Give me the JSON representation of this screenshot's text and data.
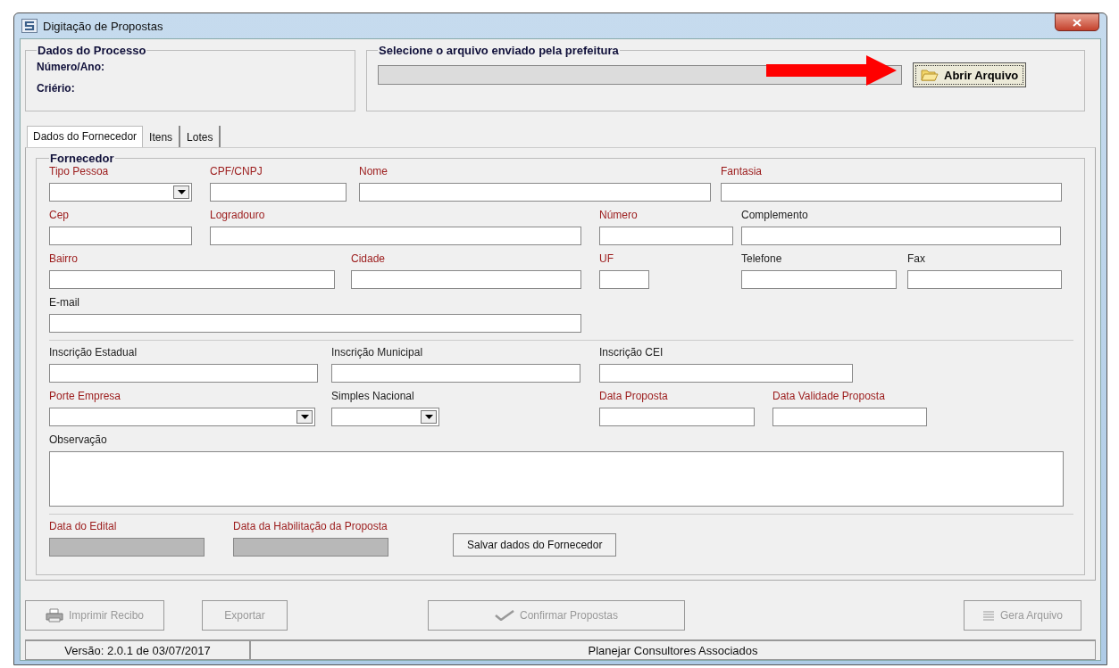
{
  "window": {
    "title": "Digitação de Propostas"
  },
  "process_group": {
    "title": "Dados do Processo",
    "lines": [
      "Número/Ano:",
      "Criério:"
    ]
  },
  "file_group": {
    "title": "Selecione o arquivo enviado pela prefeitura",
    "button": "Abrir Arquivo"
  },
  "tabs": [
    {
      "label": "Dados do Fornecedor",
      "selected": true
    },
    {
      "label": "Itens",
      "selected": false
    },
    {
      "label": "Lotes",
      "selected": false
    }
  ],
  "supplier": {
    "title": "Fornecedor",
    "field_lines": [
      [
        {
          "label": "Tipo Pessoa",
          "required": true,
          "kind": "select"
        },
        {
          "label": "CPF/CNPJ",
          "required": true,
          "kind": "text"
        },
        {
          "label": "Nome",
          "required": true,
          "kind": "text"
        },
        {
          "label": "Fantasia",
          "required": true,
          "kind": "text"
        }
      ],
      [
        {
          "label": "Cep",
          "required": true,
          "kind": "text"
        },
        {
          "label": "Logradouro",
          "required": true,
          "kind": "text"
        },
        {
          "label": "Número",
          "required": true,
          "kind": "text"
        },
        {
          "label": "Complemento",
          "required": false,
          "kind": "text"
        }
      ],
      [
        {
          "label": "Bairro",
          "required": true,
          "kind": "text"
        },
        {
          "label": "Cidade",
          "required": true,
          "kind": "text"
        },
        {
          "label": "UF",
          "required": true,
          "kind": "text"
        },
        {
          "label": "Telefone",
          "required": false,
          "kind": "text"
        },
        {
          "label": "Fax",
          "required": false,
          "kind": "text"
        }
      ],
      [
        {
          "label": "E-mail",
          "required": false,
          "kind": "text"
        }
      ],
      [
        {
          "label": "Inscrição Estadual",
          "required": false,
          "kind": "text"
        },
        {
          "label": "Inscrição Municipal",
          "required": false,
          "kind": "text"
        },
        {
          "label": "Inscrição CEI",
          "required": false,
          "kind": "text"
        }
      ],
      [
        {
          "label": "Porte Empresa",
          "required": true,
          "kind": "select"
        },
        {
          "label": "Simples Nacional",
          "required": false,
          "kind": "select"
        },
        {
          "label": "Data Proposta",
          "required": true,
          "kind": "text"
        },
        {
          "label": "Data Validade Proposta",
          "required": true,
          "kind": "text"
        }
      ],
      [
        {
          "label": "Observação",
          "required": false,
          "kind": "textarea"
        }
      ],
      [
        {
          "label": "Data do Edital",
          "required": true,
          "kind": "disabled"
        },
        {
          "label": "Data da Habilitação da Proposta",
          "required": true,
          "kind": "disabled"
        }
      ]
    ],
    "save_button": "Salvar dados do Fornecedor"
  },
  "buttons": [
    {
      "label": "Imprimir Recibo",
      "disabled": true,
      "kind": "print"
    },
    {
      "label": "Exportar",
      "disabled": true,
      "kind": "plain"
    },
    {
      "label": "Confirmar Propostas",
      "disabled": true,
      "kind": "check"
    },
    {
      "label": "Gera Arquivo",
      "disabled": true,
      "kind": "lines"
    }
  ],
  "status_bar": [
    "Versão: 2.0.1 de 03/07/2017",
    "Planejar Consultores Associados"
  ]
}
